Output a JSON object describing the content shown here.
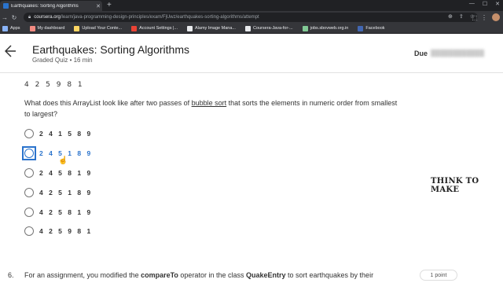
{
  "browser": {
    "tab_title": "Earthquakes: Sorting Algorithms",
    "url_host": "coursera.org",
    "url_path": "/learn/java-programming-design-principles/exam/FjUwz/earthquakes-sorting-algorithms/attempt",
    "bookmarks": [
      {
        "label": "Apps",
        "color": "#8ab4f8"
      },
      {
        "label": "My dashboard",
        "color": "#f28b82"
      },
      {
        "label": "Upload Your Conte...",
        "color": "#fdd663"
      },
      {
        "label": "Account Settings |...",
        "color": "#ea4335"
      },
      {
        "label": "Alamy Image Mana...",
        "color": "#e8eaed"
      },
      {
        "label": "Coursera-Java-for-...",
        "color": "#e8eaed"
      },
      {
        "label": "jobs.sbovweb.org.in",
        "color": "#81c995"
      },
      {
        "label": "Facebook",
        "color": "#4267b2"
      }
    ]
  },
  "header": {
    "title": "Earthquakes: Sorting Algorithms",
    "subtitle": "Graded Quiz • 16 min",
    "due_label": "Due"
  },
  "quiz": {
    "previous_answer": "4 2 5 9 8 1",
    "question_pre": "What does this ArrayList look like after two passes of ",
    "question_link": "bubble sort",
    "question_post": " that sorts the elements in numeric order from smallest to largest?",
    "options": [
      "2 4 1 5 8 9",
      "2 4 5 1 8 9",
      "2 4 5 8 1 9",
      "4 2 5 1 8 9",
      "4 2 5 8 1 9",
      "4 2 5 9 8 1"
    ],
    "focused_option_index": 1
  },
  "watermark": "THINK TO MAKE",
  "next_question": {
    "number": "6.",
    "text_pre": "For an assignment, you modified the ",
    "text_b1": "compareTo",
    "text_mid": " operator in the class ",
    "text_b2": "QuakeEntry",
    "text_post": " to sort earthquakes by their",
    "points": "1 point"
  },
  "colors": {
    "accent": "#2a73cc",
    "chrome_dark": "#202124",
    "chrome": "#35363a"
  }
}
